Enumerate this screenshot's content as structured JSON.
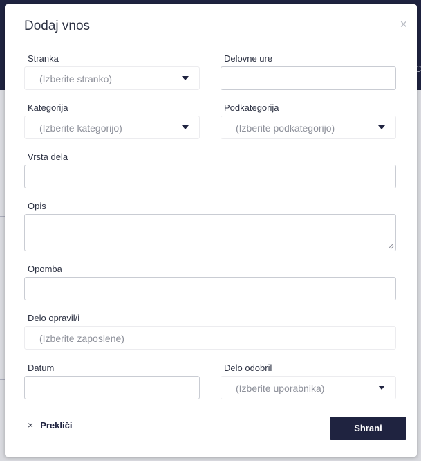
{
  "background": {
    "right_text": "C"
  },
  "modal": {
    "title": "Dodaj vnos",
    "close_icon": "×"
  },
  "fields": {
    "stranka": {
      "label": "Stranka",
      "placeholder": "(Izberite stranko)"
    },
    "delovne_ure": {
      "label": "Delovne ure",
      "value": ""
    },
    "kategorija": {
      "label": "Kategorija",
      "placeholder": "(Izberite kategorijo)"
    },
    "podkategorija": {
      "label": "Podkategorija",
      "placeholder": "(Izberite podkategorijo)"
    },
    "vrsta_dela": {
      "label": "Vrsta dela",
      "value": ""
    },
    "opis": {
      "label": "Opis",
      "value": ""
    },
    "opomba": {
      "label": "Opomba",
      "value": ""
    },
    "delo_opravil": {
      "label": "Delo opravil/i",
      "placeholder": "(Izberite zaposlene)"
    },
    "datum": {
      "label": "Datum",
      "value": ""
    },
    "delo_odobril": {
      "label": "Delo odobril",
      "placeholder": "(Izberite uporabnika)"
    }
  },
  "footer": {
    "cancel_icon": "×",
    "cancel_label": "Prekliči",
    "save_label": "Shrani"
  },
  "colors": {
    "primary": "#1f2340",
    "text": "#2e3344",
    "placeholder": "#8d909a",
    "border": "#c9ccd3"
  }
}
